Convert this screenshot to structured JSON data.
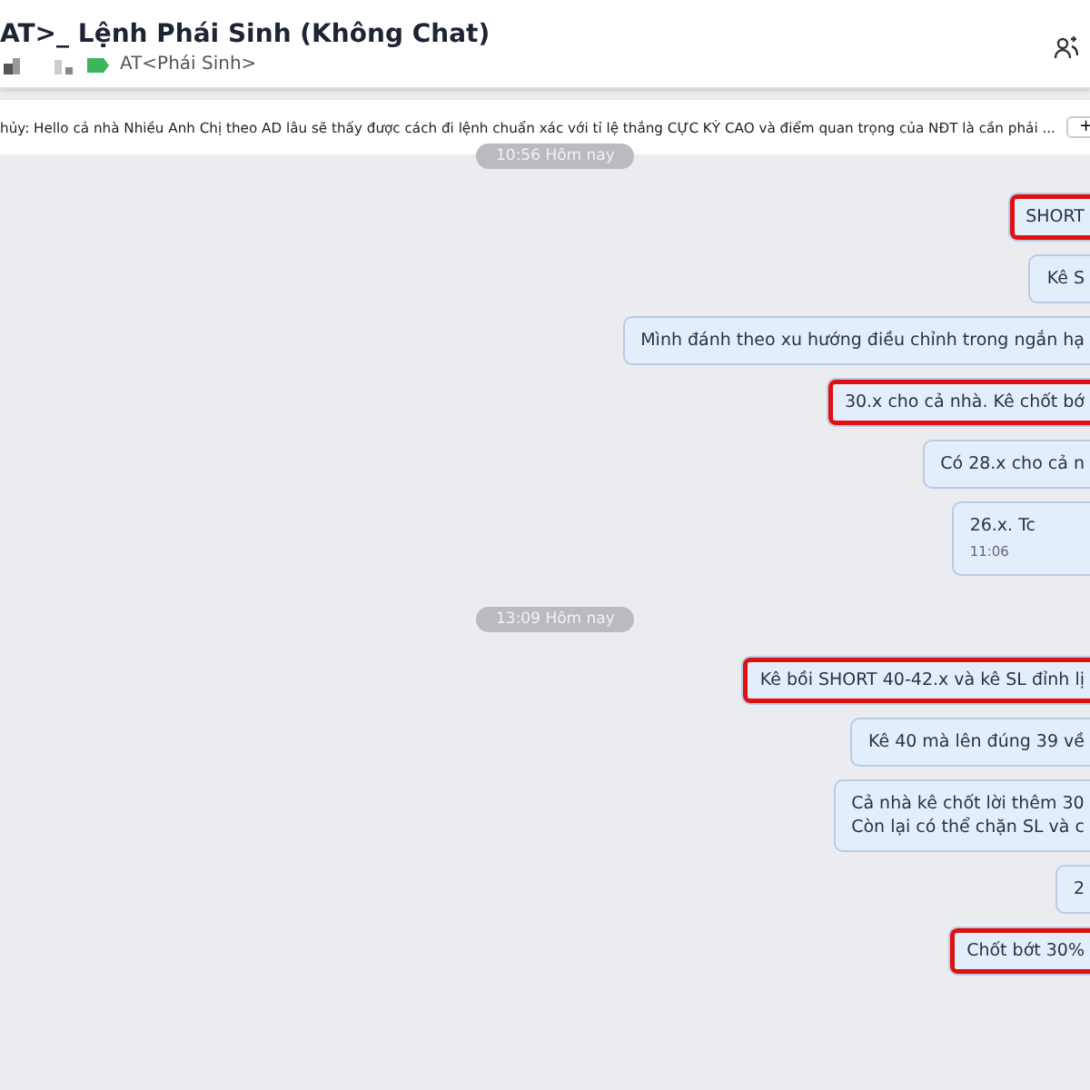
{
  "header": {
    "title": "AT>_ Lệnh Phái Sinh (Không Chat)",
    "tag": "AT<Phái Sinh>"
  },
  "pinned": {
    "text": "hủy: Hello cả nhà Nhiều Anh Chị theo AD lâu sẽ thấy được cách đi lệnh chuẩn xác với tỉ lệ thắng CỰC KỲ CAO và điểm quan trọng của NĐT là cần phải ...",
    "button": "+"
  },
  "messages": [
    {
      "kind": "date",
      "text": "10:56 Hôm nay"
    },
    {
      "kind": "bubble",
      "lines": [
        "SHORT"
      ],
      "highlighted": true
    },
    {
      "kind": "bubble",
      "lines": [
        "Kê S"
      ],
      "highlighted": false
    },
    {
      "kind": "bubble",
      "lines": [
        "Mình đánh theo xu hướng điều chỉnh trong ngắn hạ"
      ],
      "highlighted": false
    },
    {
      "kind": "bubble",
      "lines": [
        "30.x cho cả nhà. Kê chốt bớ"
      ],
      "highlighted": true
    },
    {
      "kind": "bubble",
      "lines": [
        "Có 28.x cho cả n"
      ],
      "highlighted": false
    },
    {
      "kind": "bubble",
      "lines": [
        "26.x. Tc"
      ],
      "time": "11:06",
      "highlighted": false
    },
    {
      "kind": "date",
      "text": "13:09 Hôm nay"
    },
    {
      "kind": "bubble",
      "lines": [
        "Kê bồi SHORT 40-42.x và kê SL đỉnh lị"
      ],
      "highlighted": true
    },
    {
      "kind": "bubble",
      "lines": [
        "Kê 40 mà lên đúng 39 về"
      ],
      "highlighted": false
    },
    {
      "kind": "bubble",
      "lines": [
        "Cả nhà kê chốt lời thêm 30",
        "Còn lại có thể chặn SL và c"
      ],
      "highlighted": false
    },
    {
      "kind": "bubble",
      "lines": [
        "2"
      ],
      "highlighted": false
    },
    {
      "kind": "bubble",
      "lines": [
        "Chốt bớt 30%"
      ],
      "highlighted": true
    }
  ]
}
